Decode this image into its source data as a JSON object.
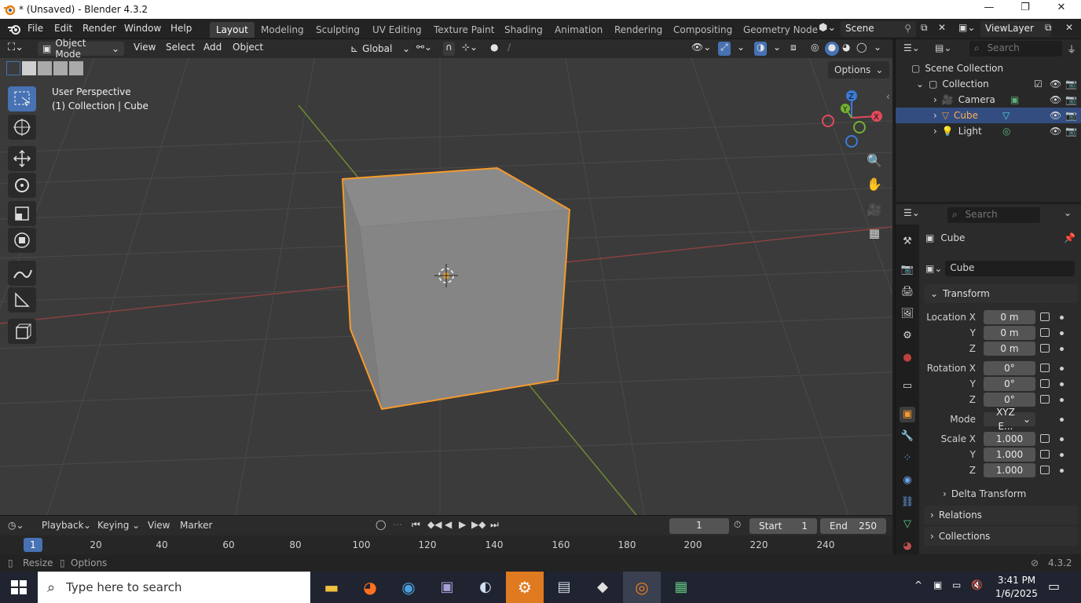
{
  "window": {
    "title": "* (Unsaved) - Blender 4.3.2"
  },
  "menu": [
    "File",
    "Edit",
    "Render",
    "Window",
    "Help"
  ],
  "workspaces": [
    "Layout",
    "Modeling",
    "Sculpting",
    "UV Editing",
    "Texture Paint",
    "Shading",
    "Animation",
    "Rendering",
    "Compositing",
    "Geometry Node"
  ],
  "scene_name": "Scene",
  "view_layer": "ViewLayer",
  "viewport_header": {
    "mode": "Object Mode",
    "menus": [
      "View",
      "Select",
      "Add",
      "Object"
    ],
    "orientation": "Global",
    "options": "Options"
  },
  "viewport": {
    "perspective": "User Perspective",
    "context": "(1) Collection | Cube",
    "gizmo": {
      "x": "X",
      "y": "Y",
      "z": "Z"
    }
  },
  "outliner": {
    "search_placeholder": "Search",
    "scene_collection": "Scene Collection",
    "collection": "Collection",
    "items": [
      "Camera",
      "Cube",
      "Light"
    ],
    "selected": "Cube"
  },
  "properties": {
    "search_placeholder": "Search",
    "object_name": "Cube",
    "data_name": "Cube",
    "transform_label": "Transform",
    "location_label": "Location X",
    "rotation_label": "Rotation X",
    "mode_label": "Mode",
    "scale_label": "Scale X",
    "axis_y": "Y",
    "axis_z": "Z",
    "location": [
      "0 m",
      "0 m",
      "0 m"
    ],
    "rotation": [
      "0°",
      "0°",
      "0°"
    ],
    "rotation_mode": "XYZ E...",
    "scale": [
      "1.000",
      "1.000",
      "1.000"
    ],
    "delta_transform": "Delta Transform",
    "relations": "Relations",
    "collections": "Collections"
  },
  "timeline": {
    "menus": [
      "Playback",
      "Keying",
      "View",
      "Marker"
    ],
    "current_frame": "1",
    "start_label": "Start",
    "start": "1",
    "end_label": "End",
    "end": "250",
    "ruler": [
      "1",
      "20",
      "40",
      "60",
      "80",
      "100",
      "120",
      "140",
      "160",
      "180",
      "200",
      "220",
      "240"
    ]
  },
  "statusbar": {
    "left1": "Resize",
    "left2": "Options",
    "version": "4.3.2"
  },
  "taskbar": {
    "search_placeholder": "Type here to search",
    "time": "3:41 PM",
    "date": "1/6/2025"
  },
  "colors": {
    "accent": "#4772b3",
    "selection_outline": "#f59a2b",
    "outliner_selected": "#334d80"
  }
}
